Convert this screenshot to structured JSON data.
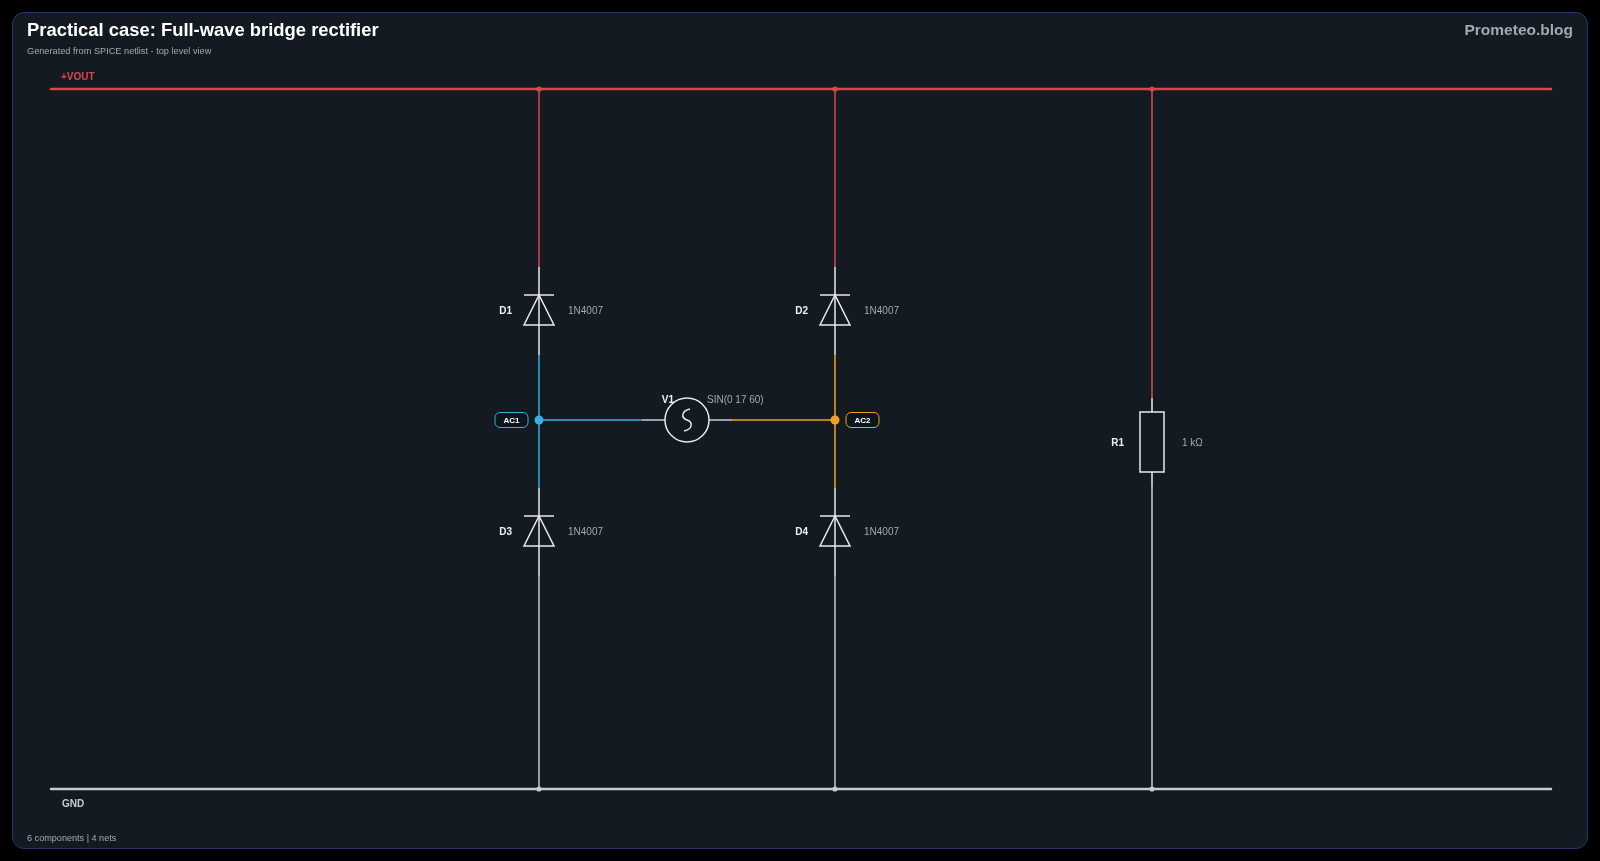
{
  "header": {
    "title": "Practical case: Full-wave bridge rectifier",
    "subtitle": "Generated from SPICE netlist - top level view",
    "brand": "Prometeo.blog"
  },
  "nets": [
    {
      "name": "+VOUT",
      "kind": "rail",
      "color": "#d9474c"
    },
    {
      "name": "AC1",
      "kind": "node",
      "color": "#3aaee6"
    },
    {
      "name": "AC2",
      "kind": "node",
      "color": "#f0a223"
    },
    {
      "name": "GND",
      "kind": "rail",
      "color": "#c6cbd4"
    }
  ],
  "components": [
    {
      "kind": "diode",
      "ref": "D1",
      "value": "1N4007"
    },
    {
      "kind": "diode",
      "ref": "D2",
      "value": "1N4007"
    },
    {
      "kind": "source",
      "ref": "V1",
      "value": "SIN(0 17 60)"
    },
    {
      "kind": "resistor",
      "ref": "R1",
      "value": "1 kΩ"
    },
    {
      "kind": "diode",
      "ref": "D3",
      "value": "1N4007"
    },
    {
      "kind": "diode",
      "ref": "D4",
      "value": "1N4007"
    }
  ],
  "footer": "6 components | 4 nets"
}
